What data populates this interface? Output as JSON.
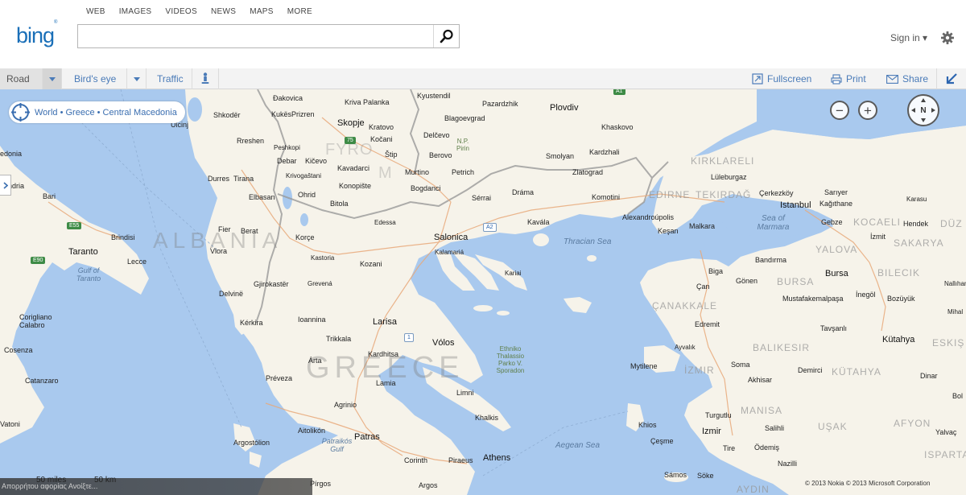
{
  "header": {
    "nav": [
      "WEB",
      "IMAGES",
      "VIDEOS",
      "NEWS",
      "MAPS",
      "MORE"
    ],
    "logo": "bing",
    "search_value": "",
    "signin": "Sign in ▾"
  },
  "toolbar": {
    "road": "Road",
    "birds_eye": "Bird's eye",
    "traffic": "Traffic",
    "fullscreen": "Fullscreen",
    "print": "Print",
    "share": "Share"
  },
  "map": {
    "breadcrumb": "World • Greece • Central Macedonia",
    "zoom_out": "−",
    "zoom_in": "+",
    "compass": "N",
    "scale_miles": "50 miles",
    "scale_km": "50 km",
    "status_text": "Απορρήτου αφορίας Ανοίξτε...",
    "copyright": "© 2013 Nokia   © 2013 Microsoft Corporation",
    "countries": [
      "ALBANIA",
      "GREECE"
    ],
    "seas": [
      "Thracian Sea",
      "Aegean Sea",
      "Sea of Marmara",
      "Gulf of Taranto",
      "Patraikós Gulf"
    ],
    "regions": [
      "KIRKLARELI",
      "EDIRNE",
      "TEKIRDAĞ",
      "KOCAELI",
      "SAKARYA",
      "YALOVA",
      "BURSA",
      "BILECIK",
      "ÇANAKKALE",
      "BALIKESIR",
      "KÜTAHYA",
      "ESKIŞ",
      "İZMIR",
      "MANISA",
      "UŞAK",
      "AFYON",
      "ISPARTA",
      "AYDIN",
      "DÜZ",
      "FYRO",
      "M"
    ],
    "park": "Ethniko Thalassio Parko V. Sporadon",
    "park2": "N.P. Pirin",
    "cities": [
      "Đakovica",
      "Kriva Palanka",
      "Kyustendil",
      "Pazardzhik",
      "Plovdiv",
      "Shkodër",
      "Kukës",
      "Prizren",
      "Ulcinj",
      "Skopje",
      "Kratovo",
      "Blagoevgrad",
      "Khaskovo",
      "Kočani",
      "Delčevo",
      "Rreshen",
      "Peshkopi",
      "Štip",
      "Berovo",
      "Smolyan",
      "Kardzhali",
      "Debar",
      "Kičevo",
      "Kavadarci",
      "Krivogaštani",
      "Durres",
      "Tirana",
      "Murtino",
      "Petrich",
      "Zlatograd",
      "Lüleburgaz",
      "Konopište",
      "Elbasan",
      "Ohrid",
      "Bogdanci",
      "Sérrai",
      "Dráma",
      "Komotini",
      "Çerkezköy",
      "Sarıyer",
      "Kağıthane",
      "Istanbul",
      "Karasu",
      "Bitola",
      "Edessa",
      "Kavála",
      "Alexandroúpolis",
      "Keşan",
      "Malkara",
      "Gebze",
      "Hendek",
      "İzmit",
      "Fier",
      "Berat",
      "Korçe",
      "Salonica",
      "Brindisi",
      "Taranto",
      "Lecce",
      "Bari",
      "Vlora",
      "Kastoria",
      "Kalamariá",
      "Kozani",
      "Kariai",
      "Biga",
      "Bandırma",
      "Bursa",
      "Gönen",
      "Çan",
      "Mustafakemalpaşa",
      "İnegöl",
      "Bozüyük",
      "Delvinë",
      "Gjirokastër",
      "Grevená",
      "Corigliano Calabro",
      "Kérkira",
      "Ioannina",
      "Larisa",
      "Edremit",
      "Tavşanlı",
      "Kütahya",
      "Trikkala",
      "Vólos",
      "Ayvalık",
      "Cosenza",
      "Árta",
      "Kardhitsa",
      "Soma",
      "Mytilene",
      "Demirci",
      "Akhisar",
      "Préveza",
      "Lamia",
      "Catanzaro",
      "Dinar",
      "Limni",
      "Agrinio",
      "Khalkis",
      "Turgutlu",
      "Salihli",
      "Aitolikón",
      "Patras",
      "Khios",
      "Çeşme",
      "Argostólion",
      "Tire",
      "Ödemiş",
      "Nazilli",
      "Corinth",
      "Piraeus",
      "Athens",
      "Argos",
      "Pírgos",
      "Sámos",
      "Söke",
      "Vatoni",
      "Nallıhan",
      "Mihal",
      "Yalvaç",
      "Bol",
      "edonia",
      "ndria",
      "Izmir"
    ],
    "shields": [
      "A1",
      "75",
      "E55",
      "E90",
      "A2",
      "1"
    ]
  }
}
